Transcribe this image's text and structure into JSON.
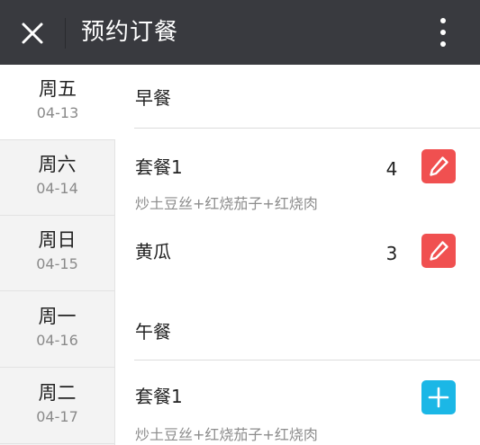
{
  "appbar": {
    "title": "预约订餐",
    "close_icon": "close-icon",
    "more_icon": "more-vertical-icon",
    "background": "#393a3f"
  },
  "days": [
    {
      "name": "周五",
      "date": "04-13",
      "active": true
    },
    {
      "name": "周六",
      "date": "04-14",
      "active": false
    },
    {
      "name": "周日",
      "date": "04-15",
      "active": false
    },
    {
      "name": "周一",
      "date": "04-16",
      "active": false
    },
    {
      "name": "周二",
      "date": "04-17",
      "active": false
    }
  ],
  "sections": [
    {
      "title": "早餐",
      "items": [
        {
          "name": "套餐1",
          "desc": "炒土豆丝+红烧茄子+红烧肉",
          "qty": "4",
          "action_icon": "edit-pencil-icon"
        },
        {
          "name": "黄瓜",
          "desc": "",
          "qty": "3",
          "action_icon": "edit-pencil-icon"
        }
      ]
    },
    {
      "title": "午餐",
      "items": [
        {
          "name": "套餐1",
          "desc": "炒土豆丝+红烧茄子+红烧肉",
          "qty": "",
          "action_icon": "plus-icon"
        }
      ]
    }
  ],
  "colors": {
    "edit_button": "#f05050",
    "add_button": "#1bb7e6",
    "sidebar_background": "#f3f3f3"
  }
}
